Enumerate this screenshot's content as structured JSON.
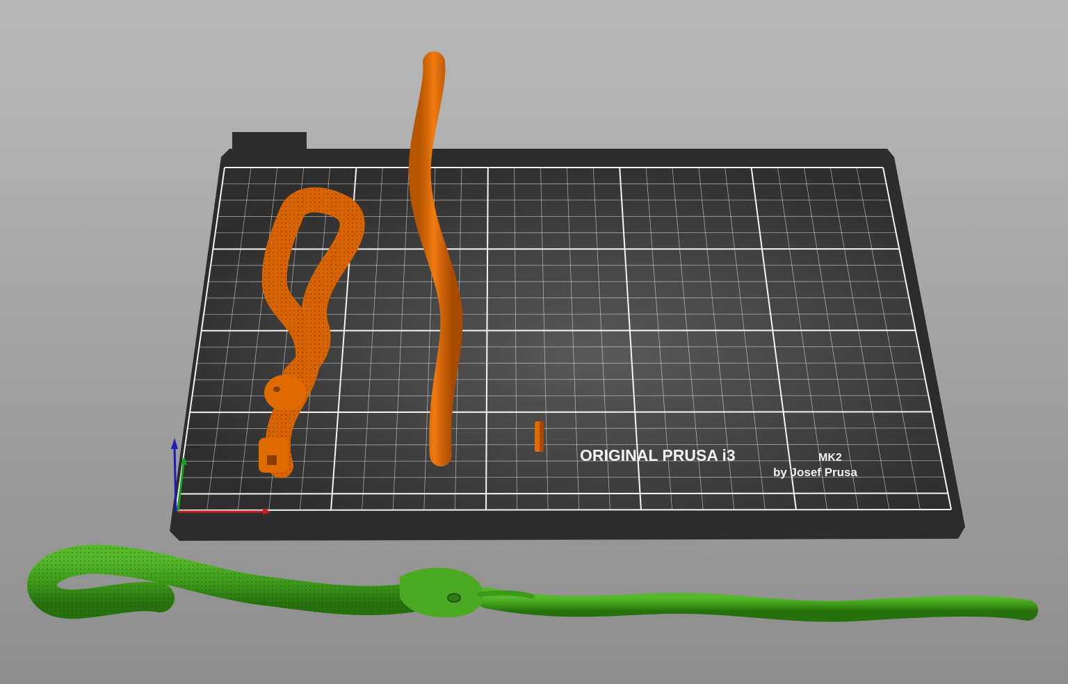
{
  "viewport": {
    "background_top": "#b8b8b8",
    "background_bottom": "#8c8c8c"
  },
  "bed": {
    "logo_line1": "ORIGINAL PRUSA i3",
    "logo_model": "MK2",
    "logo_line2": "by Josef Prusa",
    "surface_color": "#3a3a3a",
    "grid_color": "#ffffff"
  },
  "axes": {
    "x_color": "#c81e1e",
    "y_color": "#1e9e1e",
    "z_color": "#1e1eb4"
  },
  "objects": [
    {
      "name": "snake-coiled",
      "color": "#e06c00",
      "state": "on-bed"
    },
    {
      "name": "snake-tail-rod",
      "color": "#e06c00",
      "state": "on-bed"
    },
    {
      "name": "small-part",
      "color": "#e06c00",
      "state": "on-bed"
    },
    {
      "name": "snake-full",
      "color": "#3f9a1b",
      "state": "outside-bed"
    }
  ]
}
